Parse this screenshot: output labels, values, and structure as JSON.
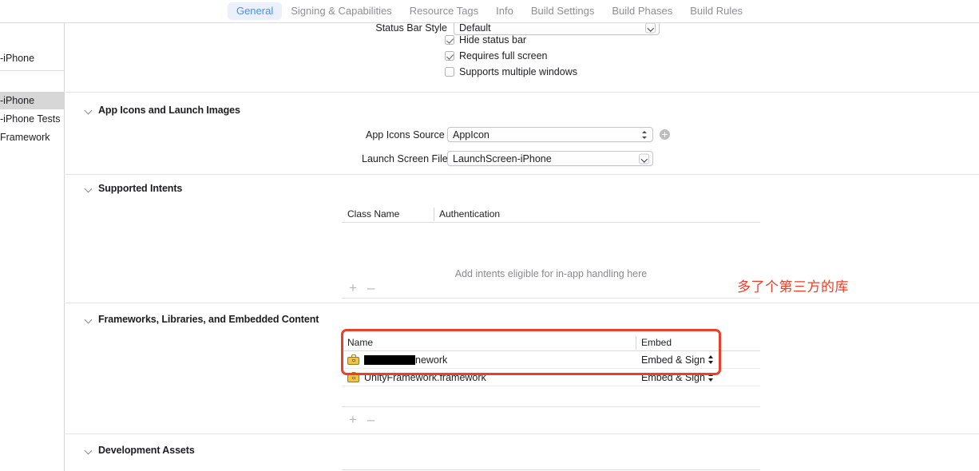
{
  "tabs": [
    {
      "label": "General",
      "active": true
    },
    {
      "label": "Signing & Capabilities",
      "active": false
    },
    {
      "label": "Resource Tags",
      "active": false
    },
    {
      "label": "Info",
      "active": false
    },
    {
      "label": "Build Settings",
      "active": false
    },
    {
      "label": "Build Phases",
      "active": false
    },
    {
      "label": "Build Rules",
      "active": false
    }
  ],
  "sidebar": {
    "items": [
      {
        "label": "-iPhone",
        "selected": false
      },
      {
        "label": "-iPhone",
        "selected": true
      },
      {
        "label": "-iPhone Tests",
        "selected": false
      },
      {
        "label": "Framework",
        "selected": false
      }
    ]
  },
  "deployment": {
    "status_bar_style_label": "Status Bar Style",
    "status_bar_style_value": "Default",
    "checkboxes": [
      {
        "label": "Hide status bar",
        "checked": true
      },
      {
        "label": "Requires full screen",
        "checked": true
      },
      {
        "label": "Supports multiple windows",
        "checked": false
      }
    ]
  },
  "app_icons": {
    "title": "App Icons and Launch Images",
    "rows": [
      {
        "label": "App Icons Source",
        "value": "AppIcon"
      },
      {
        "label": "Launch Screen File",
        "value": "LaunchScreen-iPhone"
      }
    ]
  },
  "supported_intents": {
    "title": "Supported Intents",
    "columns": [
      "Class Name",
      "Authentication"
    ],
    "empty_message": "Add intents eligible for in-app handling here",
    "add_label": "+",
    "remove_label": "–"
  },
  "frameworks": {
    "title": "Frameworks, Libraries, and Embedded Content",
    "columns": [
      "Name",
      "Embed"
    ],
    "rows": [
      {
        "name_redacted": true,
        "name": "nework",
        "embed": "Embed & Sign"
      },
      {
        "name_redacted": false,
        "name": "UnityFramework.framework",
        "embed": "Embed & Sign"
      }
    ],
    "add_label": "+",
    "remove_label": "–"
  },
  "development_assets": {
    "title": "Development Assets"
  },
  "annotation": {
    "text": "多了个第三方的库",
    "color": "#e8402a"
  }
}
